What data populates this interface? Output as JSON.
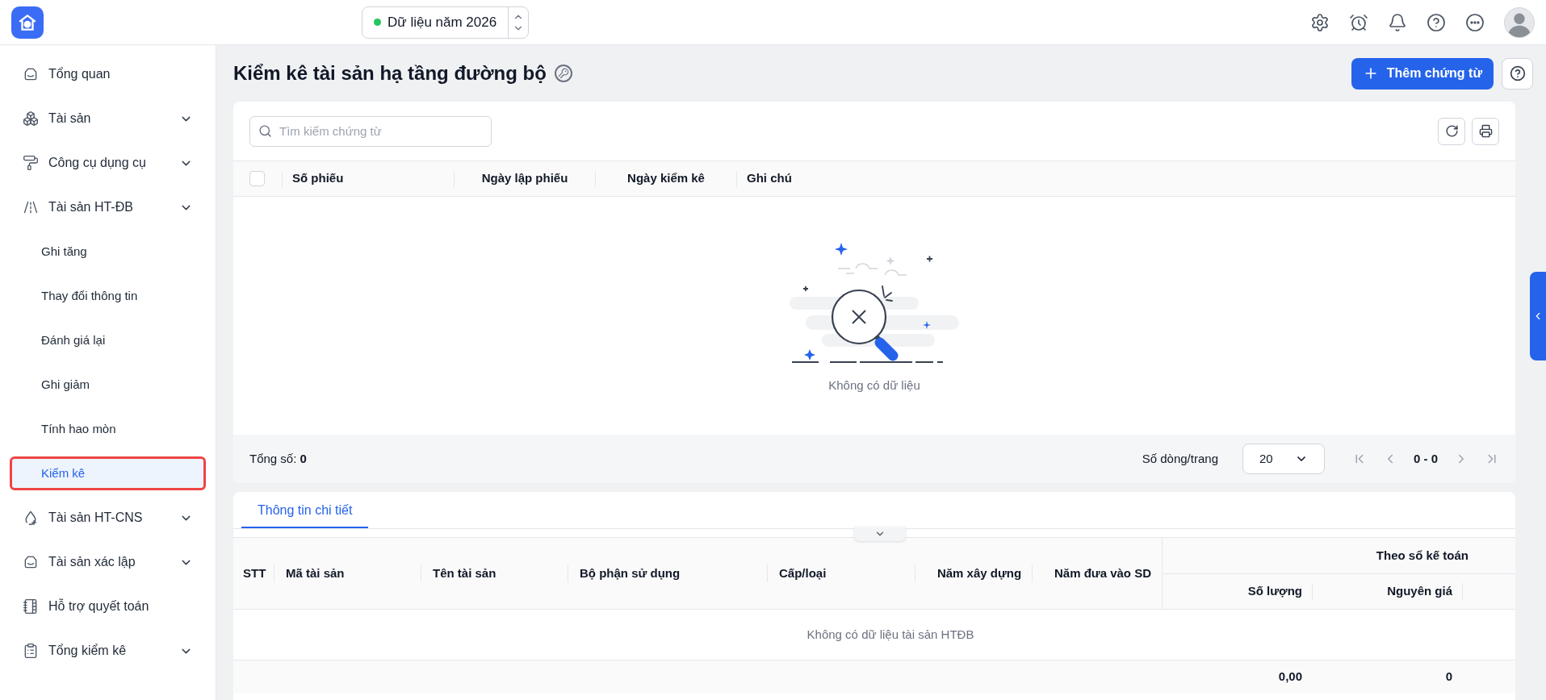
{
  "topbar": {
    "year_selector": {
      "label": "Dữ liệu năm 2026",
      "color": "#22c55e"
    }
  },
  "sidebar": {
    "items": [
      {
        "label": "Tổng quan",
        "expandable": false,
        "selected": false
      },
      {
        "label": "Tài sản",
        "expandable": true,
        "selected": false
      },
      {
        "label": "Công cụ dụng cụ",
        "expandable": true,
        "selected": false
      },
      {
        "label": "Tài sản HT-ĐB",
        "expandable": true,
        "selected": false,
        "children": [
          {
            "label": "Ghi tăng",
            "selected": false
          },
          {
            "label": "Thay đổi thông tin",
            "selected": false
          },
          {
            "label": "Đánh giá lại",
            "selected": false
          },
          {
            "label": "Ghi giảm",
            "selected": false
          },
          {
            "label": "Tính hao mòn",
            "selected": false
          },
          {
            "label": "Kiểm kê",
            "selected": true
          }
        ]
      },
      {
        "label": "Tài sản HT-CNS",
        "expandable": true,
        "selected": false
      },
      {
        "label": "Tài sản xác lập",
        "expandable": true,
        "selected": false
      },
      {
        "label": "Hỗ trợ quyết toán",
        "expandable": false,
        "selected": false
      },
      {
        "label": "Tổng kiểm kê",
        "expandable": true,
        "selected": false
      }
    ]
  },
  "page": {
    "title": "Kiểm kê tài sản hạ tầng đường bộ",
    "add_button": "Thêm chứng từ"
  },
  "list": {
    "search_placeholder": "Tìm kiếm chứng từ",
    "columns": [
      "Số phiếu",
      "Ngày lập phiếu",
      "Ngày kiểm kê",
      "Ghi chú"
    ],
    "select_all_checked": false,
    "empty_text": "Không có dữ liệu",
    "total": "Tổng số: **0**",
    "rows_per_page_label": "Số dòng/trang",
    "rows_per_page": "20",
    "range": "0 - 0"
  },
  "detail": {
    "tabs": [
      {
        "label": "Thông tin chi tiết",
        "selected": true
      }
    ],
    "columns": [
      "STT",
      "Mã tài sản",
      "Tên tài sản",
      "Bộ phận sử dụng",
      "Cấp/loại",
      "Năm xây dựng",
      "Năm đưa vào SD"
    ],
    "group": {
      "label": "Theo sổ kế toán",
      "columns": [
        "Số lượng",
        "Nguyên giá"
      ]
    },
    "empty_text": "Không có dữ liệu tài sản HTĐB",
    "totals": [
      "0,00",
      "0"
    ]
  }
}
